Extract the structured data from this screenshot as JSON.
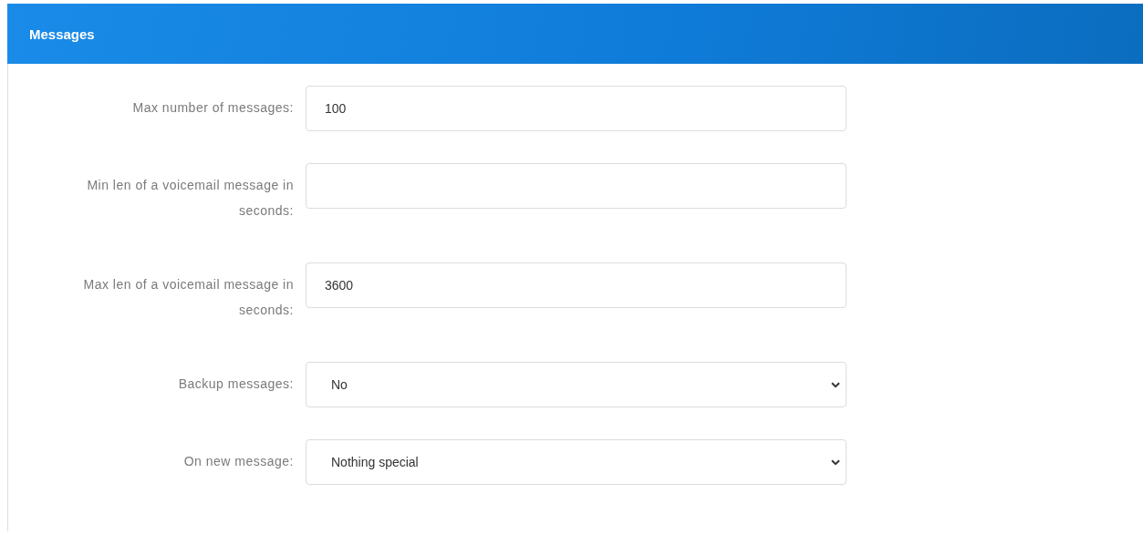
{
  "panel": {
    "title": "Messages"
  },
  "fields": [
    {
      "label": "Max number of messages:",
      "kind": "text",
      "value": "100"
    },
    {
      "label": "Min len of a voicemail message in seconds:",
      "kind": "text"
    },
    {
      "label": "Max len of a voicemail message in seconds:",
      "kind": "text",
      "value": "3600"
    },
    {
      "label": "Backup messages:",
      "kind": "select",
      "value": "No"
    },
    {
      "label": "On new message:",
      "kind": "select",
      "value": "Nothing special"
    }
  ]
}
